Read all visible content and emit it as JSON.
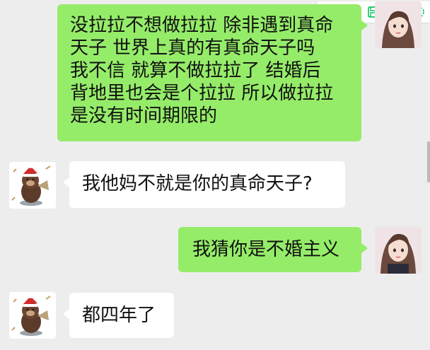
{
  "messages": {
    "m1": {
      "lines": [
        "没拉拉不想做拉拉 除非遇到真命",
        "天子 世界上真的有真命天子吗",
        "我不信 就算不做拉拉了 结婚后",
        "背地里也会是个拉拉 所以做拉拉",
        "是没有时间期限的"
      ]
    },
    "m2": {
      "text": "我他妈不就是你的真命天子?"
    },
    "m3": {
      "text": "我猜你是不婚主义"
    },
    "m4": {
      "text": "都四年了"
    }
  },
  "toolbar": {
    "icons": [
      "phone-icon",
      "expand-icon",
      "save-icon",
      "share-icon",
      "settings-icon"
    ]
  },
  "colors": {
    "accent": "#07c160",
    "bubble_self": "#95ec69",
    "bubble_other": "#ffffff",
    "background": "#ededed"
  }
}
